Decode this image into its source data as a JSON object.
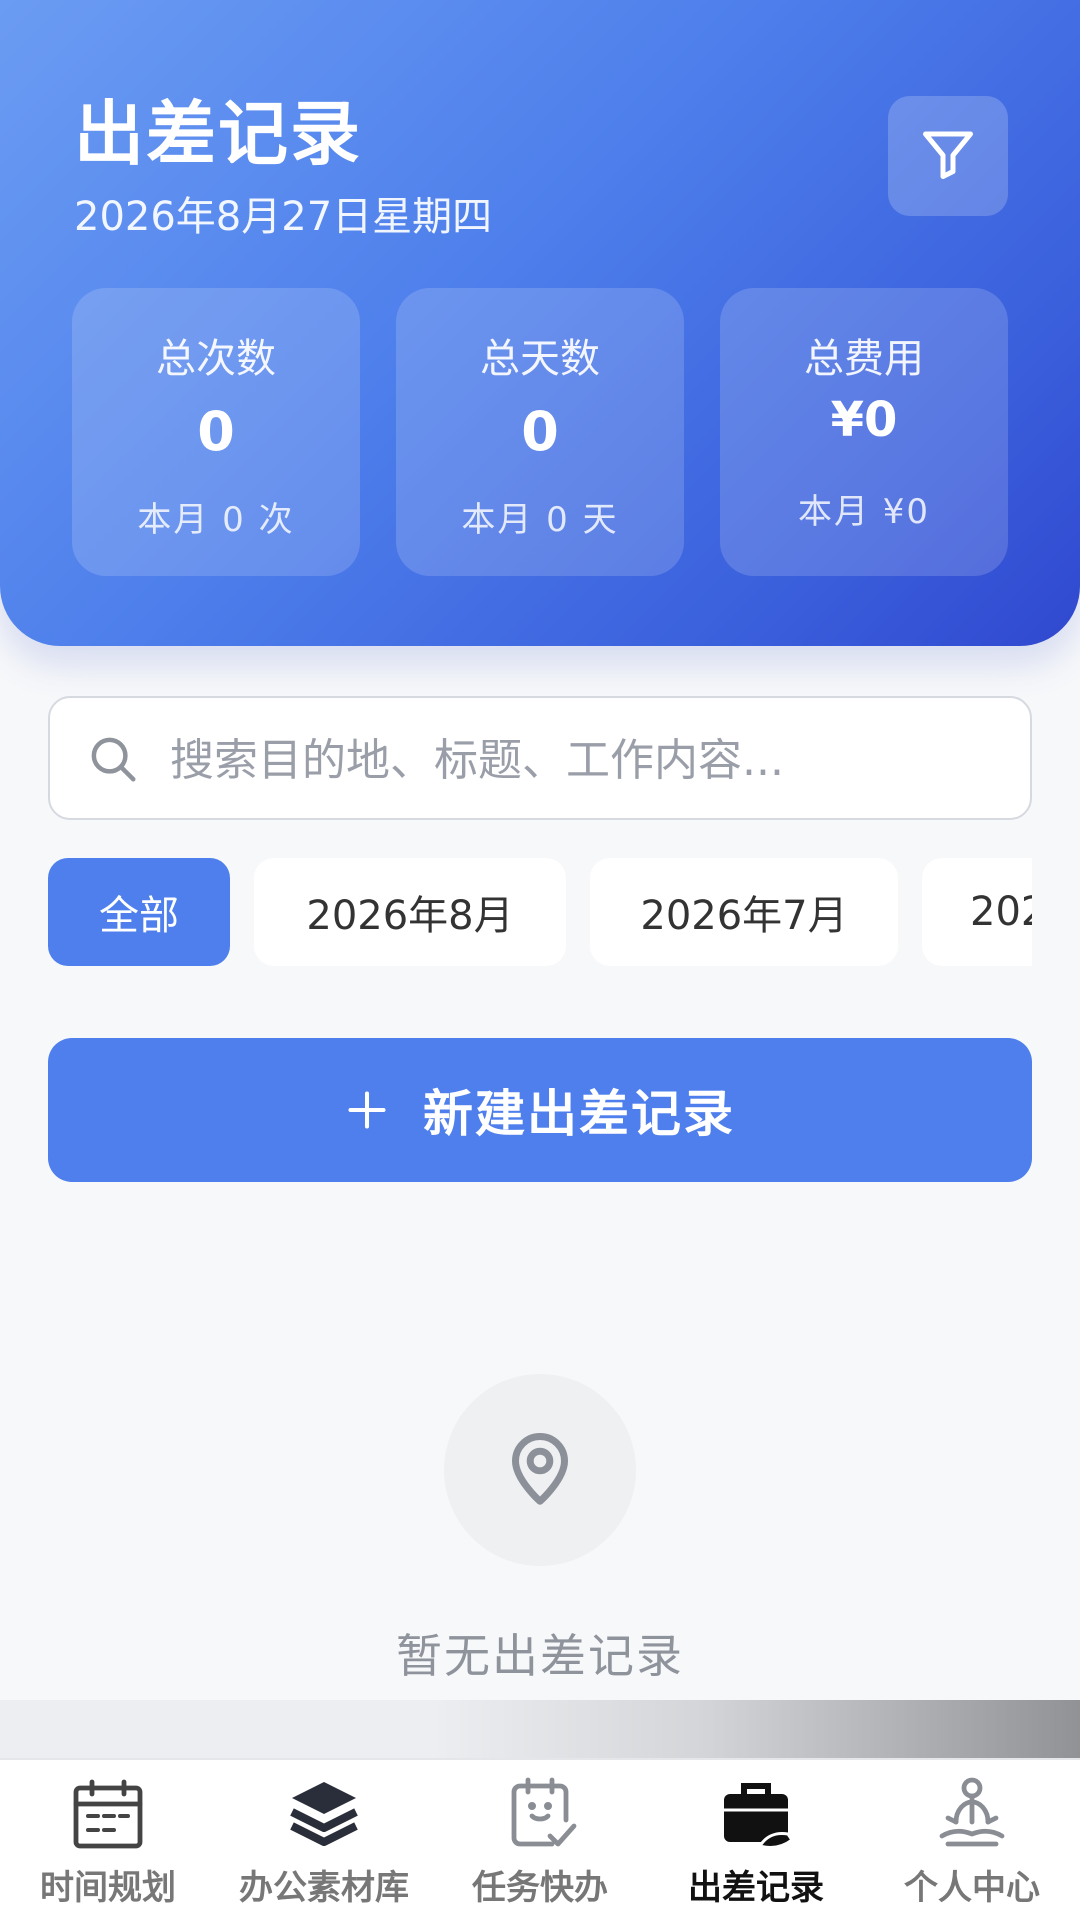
{
  "header": {
    "title": "出差记录",
    "date": "2026年8月27日星期四"
  },
  "stats": [
    {
      "label": "总次数",
      "value": "0",
      "sub": "本月 0 次"
    },
    {
      "label": "总天数",
      "value": "0",
      "sub": "本月 0 天"
    },
    {
      "label": "总费用",
      "value": "¥0",
      "sub": "本月 ¥0"
    }
  ],
  "search": {
    "placeholder": "搜索目的地、标题、工作内容...",
    "value": ""
  },
  "filters": {
    "chips": [
      "全部",
      "2026年8月",
      "2026年7月",
      "202"
    ],
    "selected": "全部"
  },
  "new_button": {
    "label": "新建出差记录"
  },
  "empty_state": {
    "text": "暂无出差记录",
    "icon": "location-pin-icon"
  },
  "tabbar": {
    "items": [
      {
        "label": "时间规划",
        "icon": "calendar-icon"
      },
      {
        "label": "办公素材库",
        "icon": "layers-icon"
      },
      {
        "label": "任务快办",
        "icon": "task-check-icon"
      },
      {
        "label": "出差记录",
        "icon": "briefcase-icon"
      },
      {
        "label": "个人中心",
        "icon": "meditation-person-icon"
      }
    ],
    "active": "出差记录"
  },
  "colors": {
    "primary": "#4e7fec",
    "header_gradient_start": "#6b9cf3",
    "header_gradient_end": "#3048cf",
    "background": "#f7f8fa"
  }
}
